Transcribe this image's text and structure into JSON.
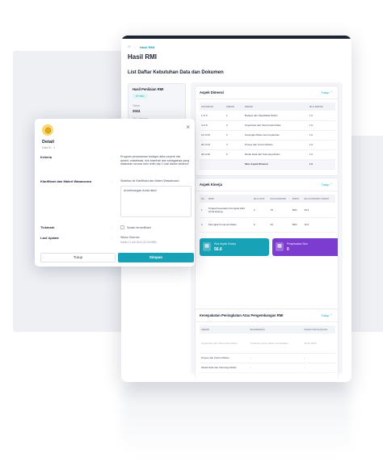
{
  "breadcrumb": {
    "current": "Hasil RMI"
  },
  "page": {
    "title": "Hasil RMI",
    "section_title": "List Daftar Kebutuhan Data dan Dokumen"
  },
  "side_card": {
    "title": "Hasil Penilaian RMI",
    "badge": "PT ABC",
    "year_label": "Tahun",
    "year": "2024",
    "status_label": "Tgl. Laporan"
  },
  "aspek_dimensi": {
    "title": "Aspek Dimensi",
    "toggle": "Tutup",
    "columns": [
      "PARAMETER",
      "DIMENSI",
      "DIMENSI",
      "NILAI DIMENSI"
    ],
    "rows": [
      [
        "1 of 9",
        "1",
        "Budaya dan Kapabilitas Risiko",
        "1.0"
      ],
      [
        "4 of 8",
        "2",
        "Organisasi dan Tata Kelola Risiko",
        "1.0"
      ],
      [
        "12 of 23",
        "3",
        "Kerangka Risiko dan Kepatuhan",
        "1.0"
      ],
      [
        "20 of 24",
        "4",
        "Proses dan Kontrol Risiko",
        "1.0"
      ],
      [
        "40 of 40",
        "5",
        "Model Data dan Teknologi Risiko",
        "1.0"
      ]
    ],
    "summary": [
      "",
      "",
      "Skor Aspek Dimensi",
      "1.0"
    ]
  },
  "aspek_kinerja": {
    "title": "Aspek Kinerja",
    "toggle": "Tutup",
    "columns": [
      "NO",
      "KPMR",
      "NILAI AKTIF",
      "NILAI KONVERSI",
      "BOBOT",
      "NILAI KONVERSI X BOBOT"
    ],
    "rows": [
      [
        "1",
        "Tingkat Kesehatan Peringkat Aktif (Total Rating)",
        "4",
        "75",
        "50%",
        "33.3"
      ],
      [
        "2",
        "Peringkat Komposit Risiko",
        "6",
        "33",
        "50%",
        "16.5"
      ]
    ],
    "score_teal": {
      "label": "Skor Aspek Kinerja",
      "value": "56.6"
    },
    "score_purple": {
      "label": "Penyesuaian Skor",
      "value": "0"
    }
  },
  "kesesuaian": {
    "title": "Kesepakatan Peningkatan Atau Pengembangan RMI",
    "toggle": "Tutup",
    "columns": [
      "DIMENSI",
      "REKOMENDASI",
      "TARGET PENYELESAIAN"
    ],
    "rows": [
      [
        "Organisasi dan Tata Kelola Risiko",
        "Terdapat proses dalam perusahaan...",
        "05-06-2025"
      ],
      [
        "Proses dan Kontrol Risiko",
        "-",
        "-"
      ],
      [
        "Model Data dan Teknologi Risiko",
        "-",
        "-"
      ]
    ]
  },
  "modal": {
    "title": "Detail",
    "subtitle": "Data ID : 1",
    "criteria_label": "Kriteria",
    "criteria_text": "Program penanaman budaya risiko seperti risk award, sosialisasi, risk townhall dan sebagainya yang dilakukan secara rutin lebih dari 1 kali dalam setahun",
    "klarifikasi_label": "Klarifikasi dan Materi Wawancara",
    "klarifikasi_text": "Silahkan isi Klarifikasi dan Materi Wawancara",
    "textarea_value": "isi keterangan Anda disini",
    "tickmark_label": "Tickmark",
    "tickmark_text": "Sudah terverifikasi",
    "last_update_label": "Last Update",
    "last_update_name": "Wisnu Subroto",
    "last_update_date": "Kamis 11 Juli 2024 (12:05 WIB)",
    "cancel_label": "Tutup",
    "save_label": "Simpan",
    "colon": ":"
  }
}
